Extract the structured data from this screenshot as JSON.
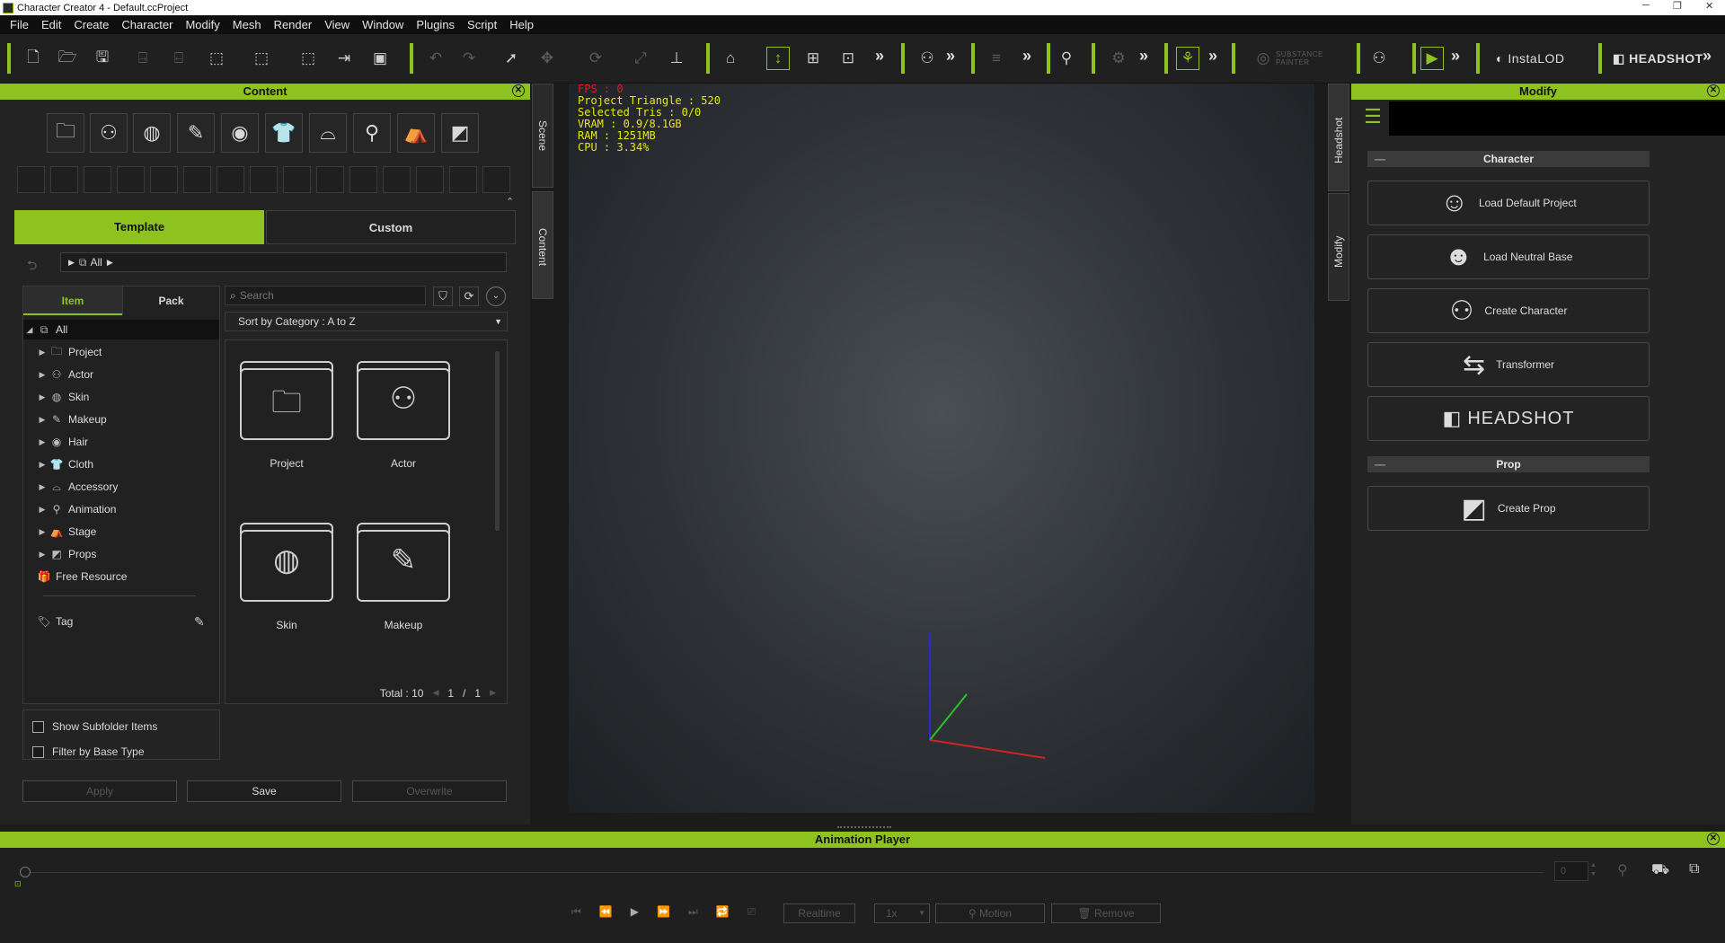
{
  "window": {
    "title": "Character Creator 4 - Default.ccProject"
  },
  "menu": [
    "File",
    "Edit",
    "Create",
    "Character",
    "Modify",
    "Mesh",
    "Render",
    "View",
    "Window",
    "Plugins",
    "Script",
    "Help"
  ],
  "toolbar": {
    "substance_label": "SUBSTANCE PAINTER",
    "instalod_label": "InstaLOD",
    "headshot_label": "HEADSHOT"
  },
  "content_panel": {
    "title": "Content",
    "tabs": [
      "Template",
      "Custom"
    ],
    "breadcrumb": "All",
    "subtabs": [
      "Item",
      "Pack"
    ],
    "search_placeholder": "Search",
    "sort": "Sort by Category : A to Z",
    "tree": [
      "All",
      "Project",
      "Actor",
      "Skin",
      "Makeup",
      "Hair",
      "Cloth",
      "Accessory",
      "Animation",
      "Stage",
      "Props",
      "Free Resource"
    ],
    "tag_label": "Tag",
    "items": [
      "Project",
      "Actor",
      "Skin",
      "Makeup"
    ],
    "total": "Total : 10",
    "page_current": "1",
    "page_sep": "/",
    "page_total": "1",
    "show_subfolder": "Show Subfolder Items",
    "filter_base": "Filter by Base Type",
    "apply": "Apply",
    "save": "Save",
    "overwrite": "Overwrite"
  },
  "side_tabs": {
    "scene": "Scene",
    "content": "Content",
    "headshot": "Headshot",
    "modify": "Modify"
  },
  "viewport": {
    "fps": "FPS : 0",
    "stats": [
      "Project Triangle : 520",
      "Selected Tris : 0/0",
      "VRAM : 0.9/8.1GB",
      "RAM : 1251MB",
      "CPU : 3.34%"
    ]
  },
  "modify_panel": {
    "title": "Modify",
    "section_character": "Character",
    "buttons": [
      "Load Default Project",
      "Load Neutral Base",
      "Create Character",
      "Transformer"
    ],
    "headshot": "HEADSHOT",
    "section_prop": "Prop",
    "create_prop": "Create Prop"
  },
  "animation_player": {
    "title": "Animation Player",
    "frame": "0",
    "realtime": "Realtime",
    "speed": "1x",
    "motion": "Motion",
    "remove": "Remove"
  }
}
